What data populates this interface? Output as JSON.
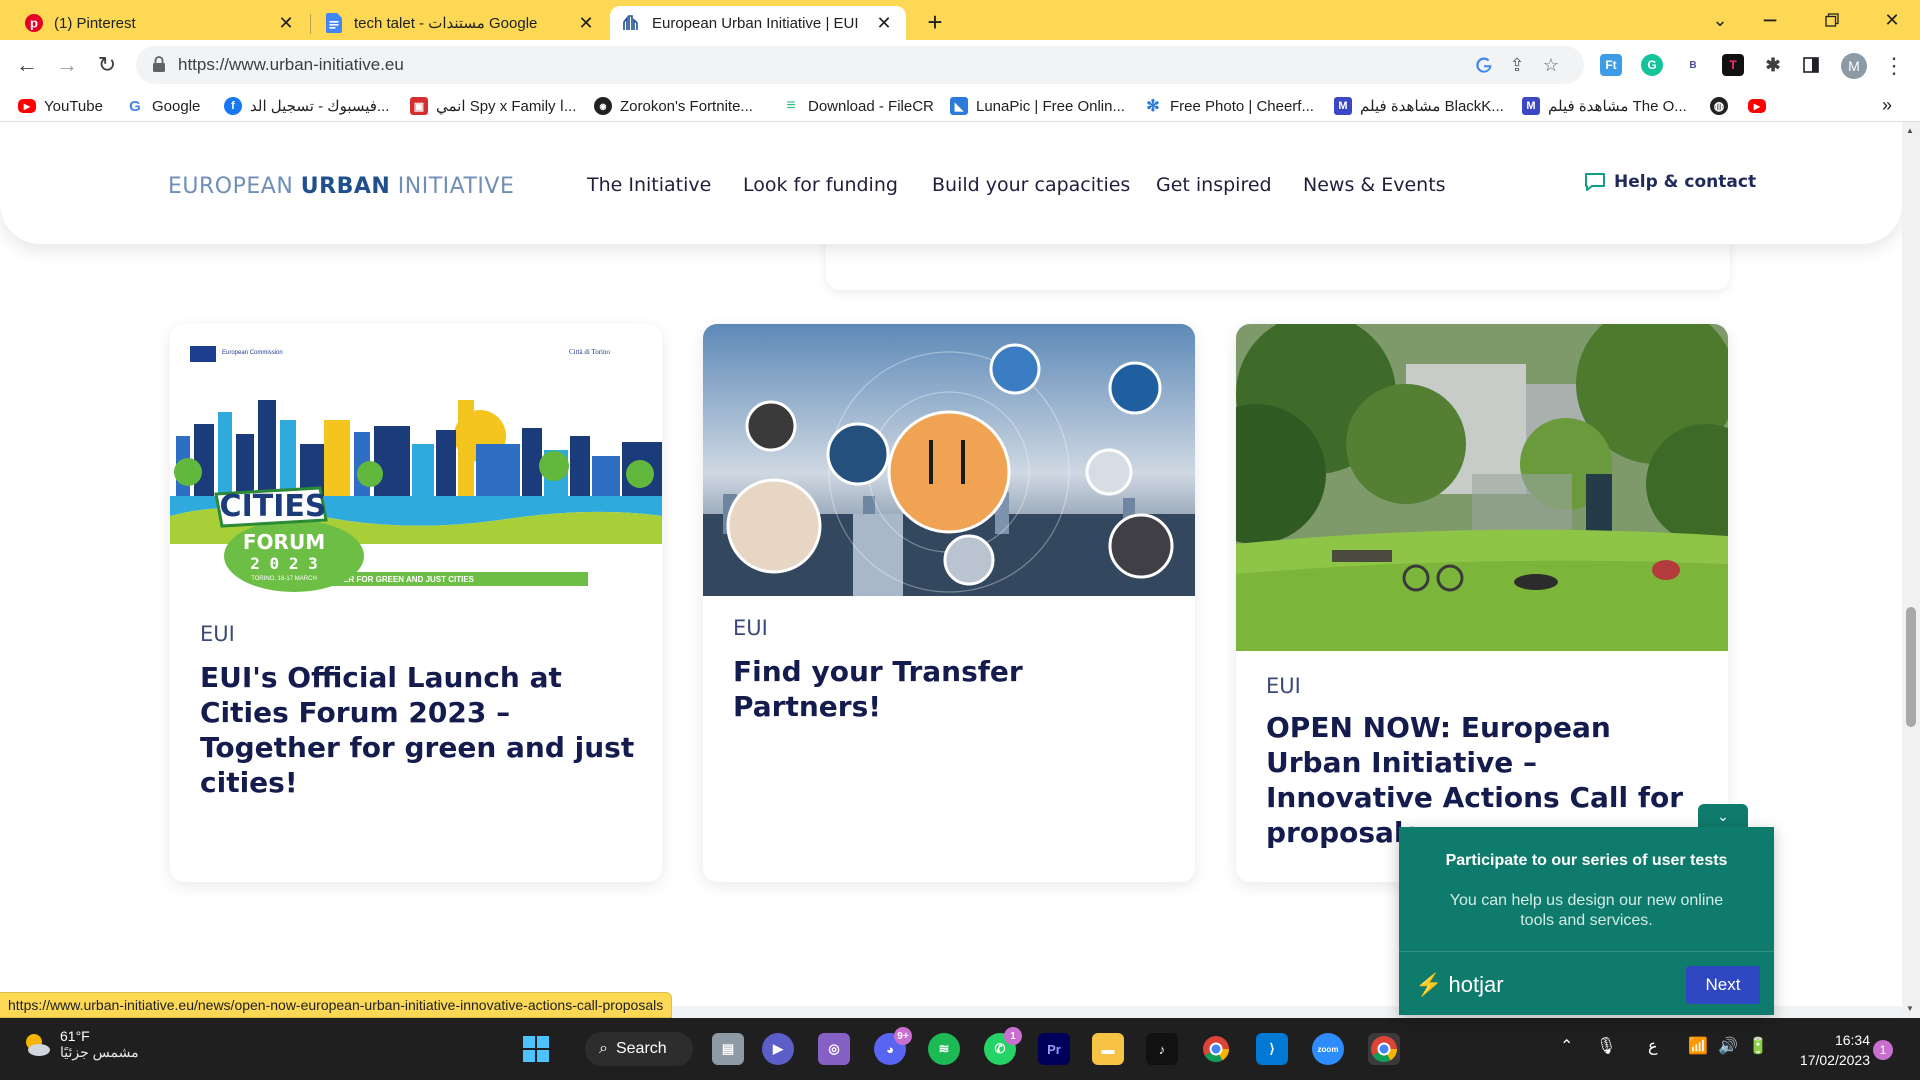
{
  "browser": {
    "tabs": [
      {
        "title": "(1) Pinterest",
        "active": false
      },
      {
        "title": "tech talet - مستندات Google",
        "active": false
      },
      {
        "title": "European Urban Initiative | EUI",
        "active": true
      }
    ],
    "url": "https://www.urban-initiative.eu",
    "profile_initial": "M",
    "bookmarks": [
      "YouTube",
      "Google",
      "فيسبوك - تسجيل الد...",
      "انمي Spy x Family ا...",
      "Zorokon's Fortnite...",
      "Download - FileCR",
      "LunaPic | Free Onlin...",
      "Free Photo | Cheerf...",
      "مشاهدة فيلم BlackK...",
      "مشاهدة فيلم The O..."
    ],
    "status_url": "https://www.urban-initiative.eu/news/open-now-european-urban-initiative-innovative-actions-call-proposals"
  },
  "site": {
    "logo_light1": "EUROPEAN ",
    "logo_bold": "URBAN",
    "logo_light2": " INITIATIVE",
    "nav": [
      "The Initiative",
      "Look for funding",
      "Build your capacities",
      "Get inspired",
      "News & Events"
    ],
    "help_label": "Help & contact"
  },
  "cards": [
    {
      "category": "EUI",
      "title": "EUI's Official Launch at Cities Forum 2023 – Together for green and just cities!",
      "image": {
        "org_left": "European Commission",
        "org_right": "Città di Torino",
        "badge_main": "CITIES",
        "badge_sub": "FORUM",
        "badge_year": "2 0 2 3",
        "badge_place": "TORINO, 16-17 MARCH",
        "tagline": "TOGETHER FOR GREEN AND JUST CITIES"
      }
    },
    {
      "category": "EUI",
      "title": "Find your Transfer Partners!"
    },
    {
      "category": "EUI",
      "title": "OPEN NOW: European Urban Initiative – Innovative Actions Call for proposals"
    }
  ],
  "hotjar": {
    "title": "Participate to our series of user tests",
    "text": "You can help us design our new online tools and services.",
    "brand": "hotjar",
    "next_label": "Next"
  },
  "taskbar": {
    "temperature": "61°F",
    "weather_desc": "مشمس جزئيًا",
    "search_label": "Search",
    "discord_badge": "9+",
    "whatsapp_badge": "1",
    "time": "16:34",
    "date": "17/02/2023",
    "notifications": "1",
    "keyboard_lang": "ع"
  },
  "colors": {
    "tabstrip": "#fcd855",
    "eui_blue": "#1f4f8f",
    "title_navy": "#141b4d",
    "hotjar_green": "#0e7b6c",
    "hotjar_button": "#2f47c1"
  }
}
